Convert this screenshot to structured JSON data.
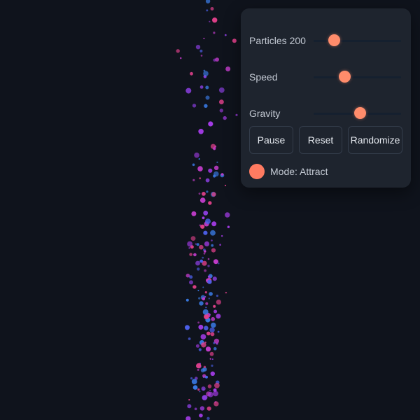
{
  "controls": {
    "particles": {
      "label": "Particles 200",
      "value": 0.23
    },
    "speed": {
      "label": "Speed",
      "value": 0.35
    },
    "gravity": {
      "label": "Gravity",
      "value": 0.53
    }
  },
  "buttons": {
    "pause": "Pause",
    "reset": "Reset",
    "randomize": "Randomize"
  },
  "mode": {
    "text": "Mode: Attract",
    "color": "#ff7b61"
  },
  "colors": {
    "background": "#0f131c",
    "accent": "#ff8c6b",
    "particle_palette": [
      "#c13cc9",
      "#8b3fe0",
      "#4b5fe8",
      "#3a7be6",
      "#e0408a",
      "#a33be6"
    ]
  }
}
